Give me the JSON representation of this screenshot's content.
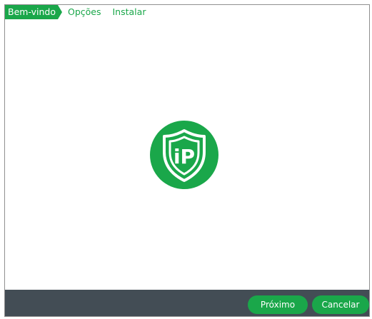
{
  "steps": [
    {
      "label": "Bem-vindo"
    },
    {
      "label": "Opções"
    },
    {
      "label": "Instalar"
    }
  ],
  "logo": {
    "text": "iP",
    "icon": "shield-ip-icon",
    "color": "#1aa74a"
  },
  "footer": {
    "next_label": "Próximo",
    "cancel_label": "Cancelar",
    "background": "#434d55"
  },
  "colors": {
    "accent": "#1aa74a"
  }
}
